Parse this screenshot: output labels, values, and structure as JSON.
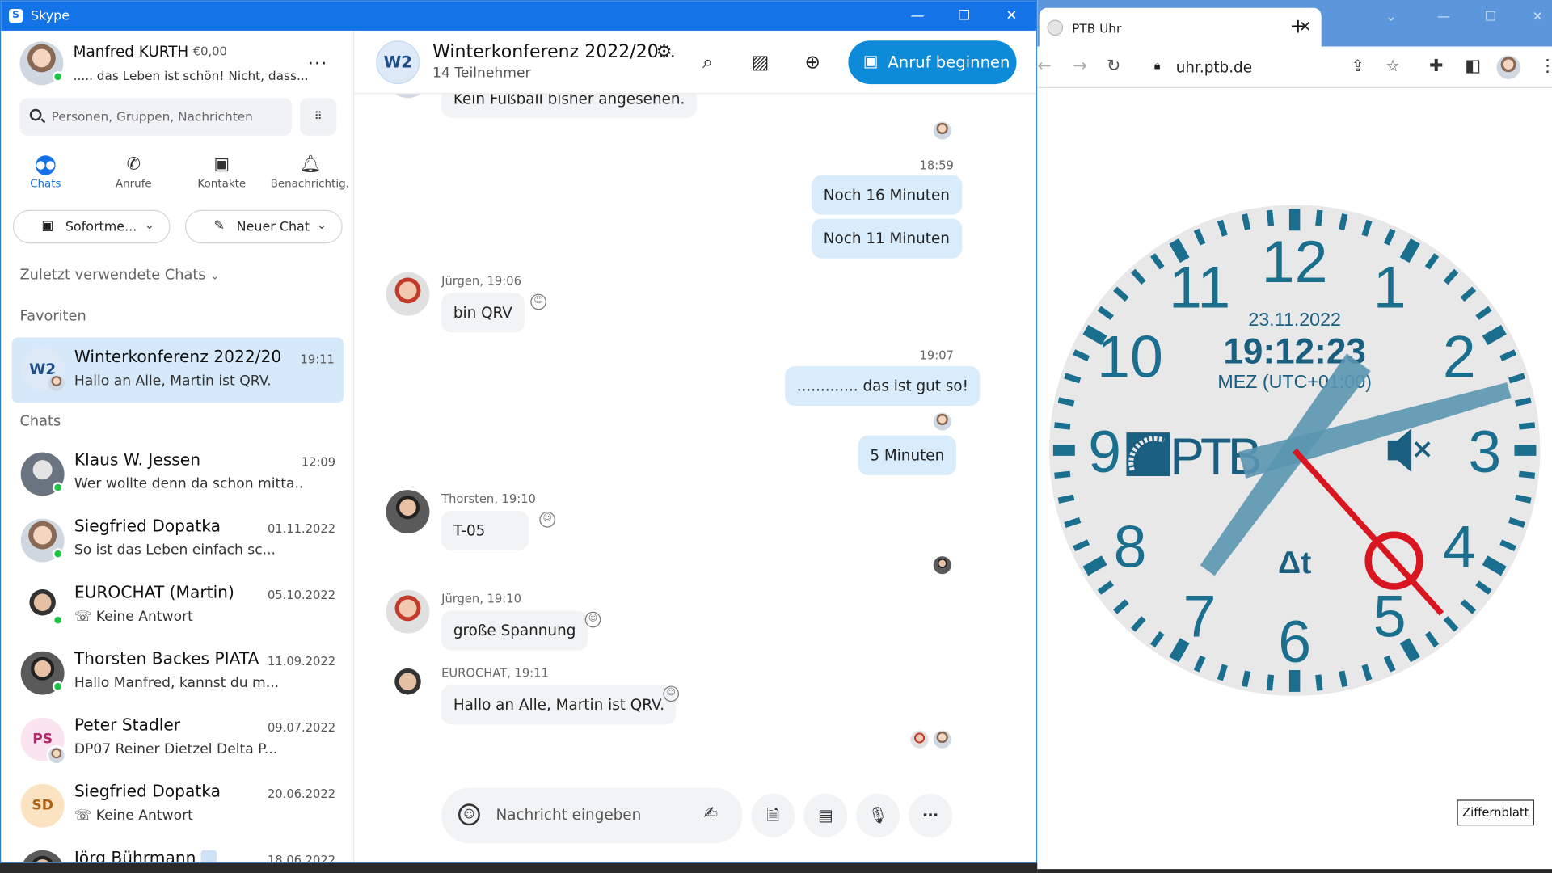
{
  "skype": {
    "window_title": "Skype",
    "profile": {
      "name": "Manfred KURTH",
      "credit": "€0,00",
      "mood": "..... das Leben ist schön! Nicht, dass...",
      "more": "..."
    },
    "search_placeholder": "Personen, Gruppen, Nachrichten",
    "nav": [
      {
        "label": "Chats"
      },
      {
        "label": "Anrufe"
      },
      {
        "label": "Kontakte"
      },
      {
        "label": "Benachrichtig."
      }
    ],
    "btn_instant": "Sofortme...",
    "btn_new_chat": "Neuer Chat",
    "recent_header": "Zuletzt verwendete Chats",
    "favorites_header": "Favoriten",
    "chats_header": "Chats",
    "favorite": {
      "name": "Winterkonferenz 2022/20...",
      "time": "19:11",
      "preview": "Hallo an Alle, Martin ist QRV.",
      "initials": "W2"
    },
    "chats": [
      {
        "name": "Klaus W. Jessen",
        "date": "12:09",
        "preview": "Wer wollte denn da schon mitta..."
      },
      {
        "name": "Siegfried Dopatka",
        "date": "01.11.2022",
        "preview": "So ist das Leben  einfach  sc..."
      },
      {
        "name": "EUROCHAT (Martin)",
        "date": "05.10.2022",
        "preview": "Keine Antwort"
      },
      {
        "name": "Thorsten Backes PIATA",
        "date": "11.09.2022",
        "preview": "Hallo Manfred, kannst du m..."
      },
      {
        "name": "Peter Stadler",
        "date": "09.07.2022",
        "preview": "DP07 Reiner Dietzel Delta P...",
        "initials": "PS"
      },
      {
        "name": "Siegfried Dopatka",
        "date": "20.06.2022",
        "preview": "Keine Antwort",
        "initials": "SD"
      },
      {
        "name": "Jörg Bührmann",
        "date": "18.06.2022",
        "preview": ""
      }
    ]
  },
  "conversation": {
    "initials": "W2",
    "title": "Winterkonferenz 2022/20...",
    "participants": "14 Teilnehmer",
    "call_button": "Anruf beginnen",
    "messages": {
      "m0": "Kein Fußball bisher angesehen.",
      "t1": "18:59",
      "m1": "Noch 16 Minuten",
      "m2": "Noch 11 Minuten",
      "s3": "Jürgen, 19:06",
      "m3": "bin QRV",
      "t4": "19:07",
      "m4": "............. das ist gut so!",
      "m5": "5 Minuten",
      "s6": "Thorsten, 19:10",
      "m6": "T-05",
      "s7": "Jürgen, 19:10",
      "m7": "große Spannung",
      "s8": "EUROCHAT, 19:11",
      "m8": "Hallo an Alle, Martin ist QRV."
    },
    "composer_placeholder": "Nachricht eingeben"
  },
  "browser": {
    "tab_title": "PTB Uhr",
    "url": "uhr.ptb.de",
    "clock": {
      "date": "23.11.2022",
      "time": "19:12:23",
      "zone": "MEZ (UTC+01:00)",
      "brand": "PTB",
      "delta": "Δt",
      "numerals": [
        "12",
        "1",
        "2",
        "3",
        "4",
        "5",
        "6",
        "7",
        "8",
        "9",
        "10",
        "11"
      ],
      "hour": 19,
      "minute": 12,
      "second": 23
    },
    "dial_button": "Ziffernblatt"
  }
}
